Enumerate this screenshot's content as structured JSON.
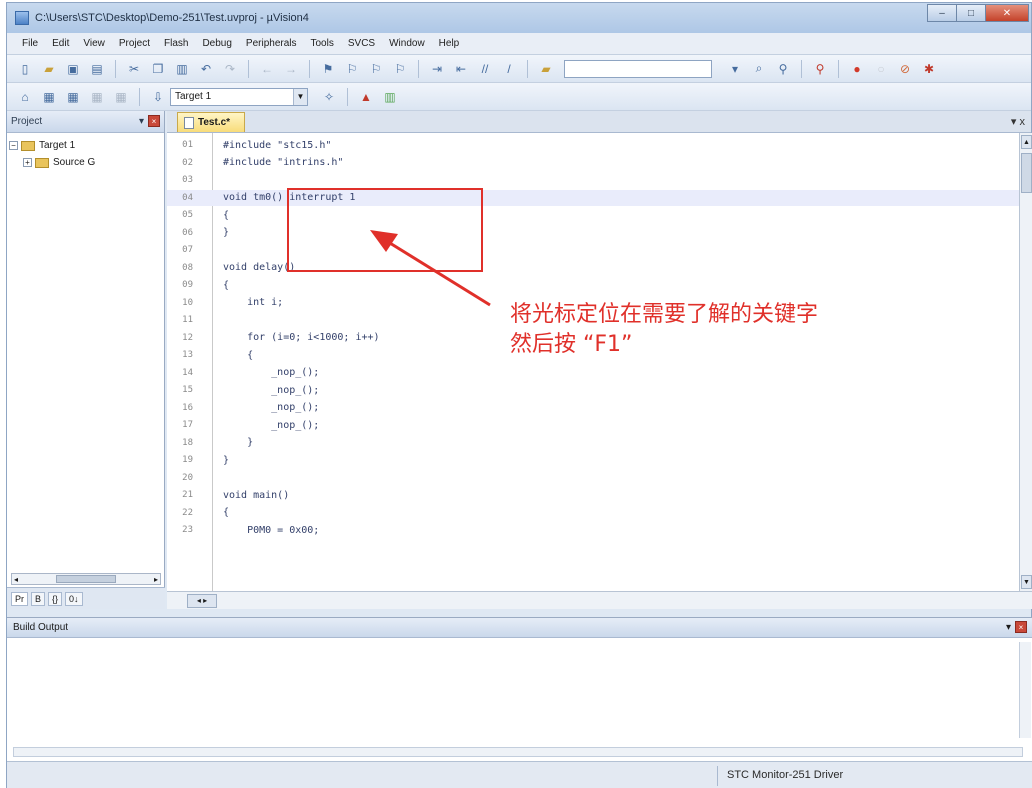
{
  "window": {
    "title": "C:\\Users\\STC\\Desktop\\Demo-251\\Test.uvproj - µVision4",
    "minimize": "–",
    "maximize": "□",
    "close": "✕"
  },
  "menu": [
    "File",
    "Edit",
    "View",
    "Project",
    "Flash",
    "Debug",
    "Peripherals",
    "Tools",
    "SVCS",
    "Window",
    "Help"
  ],
  "toolbar": {
    "target_combo": "Target 1"
  },
  "project_panel": {
    "title": "Project",
    "pin": "▾",
    "close": "×",
    "tree": [
      {
        "toggle": "−",
        "label": "Target 1"
      },
      {
        "toggle": "+",
        "label": "Source G"
      }
    ],
    "tabs": [
      "Pr",
      "B",
      "{}",
      "0↓"
    ]
  },
  "editor": {
    "tab_label": "Test.c*",
    "tab_close": "▾ x",
    "lines": [
      {
        "n": "01",
        "code": "#include \"stc15.h\""
      },
      {
        "n": "02",
        "code": "#include \"intrins.h\""
      },
      {
        "n": "03",
        "code": ""
      },
      {
        "n": "04",
        "code": "void tm0() interrupt 1"
      },
      {
        "n": "05",
        "code": "{"
      },
      {
        "n": "06",
        "code": "}"
      },
      {
        "n": "07",
        "code": ""
      },
      {
        "n": "08",
        "code": "void delay()"
      },
      {
        "n": "09",
        "code": "{"
      },
      {
        "n": "10",
        "code": "    int i;"
      },
      {
        "n": "11",
        "code": ""
      },
      {
        "n": "12",
        "code": "    for (i=0; i<1000; i++)"
      },
      {
        "n": "13",
        "code": "    {"
      },
      {
        "n": "14",
        "code": "        _nop_();"
      },
      {
        "n": "15",
        "code": "        _nop_();"
      },
      {
        "n": "16",
        "code": "        _nop_();"
      },
      {
        "n": "17",
        "code": "        _nop_();"
      },
      {
        "n": "18",
        "code": "    }"
      },
      {
        "n": "19",
        "code": "}"
      },
      {
        "n": "20",
        "code": ""
      },
      {
        "n": "21",
        "code": "void main()"
      },
      {
        "n": "22",
        "code": "{"
      },
      {
        "n": "23",
        "code": "    P0M0 = 0x00;"
      }
    ]
  },
  "annotation": {
    "line1": "将光标定位在需要了解的关键字",
    "line2": "然后按 “F1”"
  },
  "build_output": {
    "title": "Build Output",
    "pin": "▾",
    "close": "×"
  },
  "status": {
    "text": "STC Monitor-251 Driver"
  },
  "colors": {
    "annotation": "#e0302a",
    "current_line": "#e9ecfb",
    "tab_active": "#f8dc7a"
  }
}
